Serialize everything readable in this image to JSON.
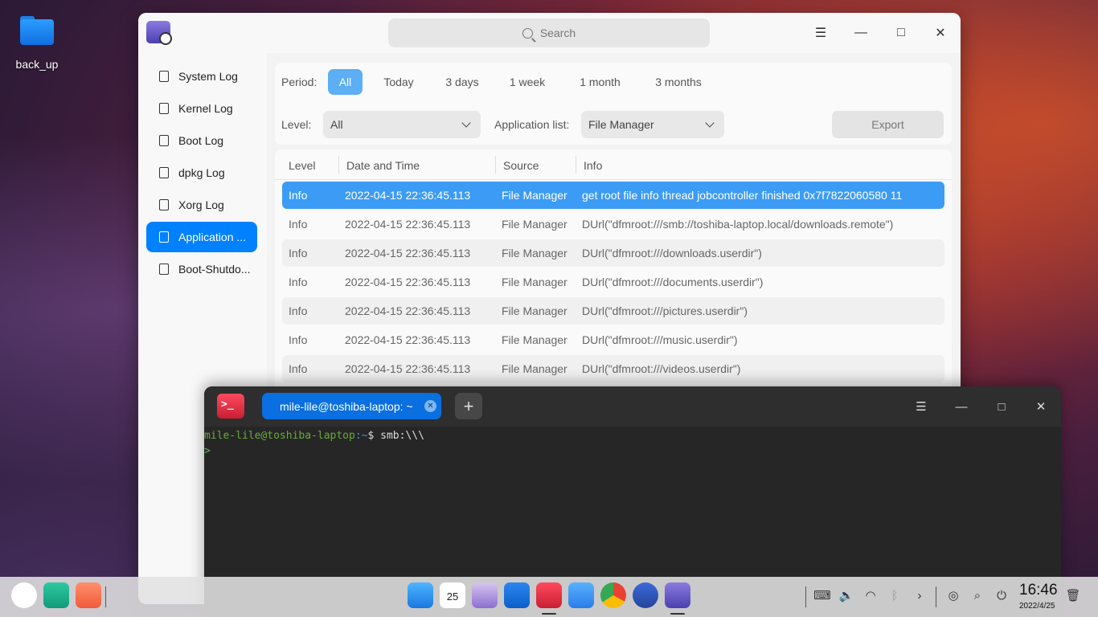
{
  "desktop": {
    "icons": [
      {
        "label": "back_up"
      }
    ]
  },
  "log_viewer": {
    "search_placeholder": "Search",
    "sidebar": [
      {
        "label": "System Log",
        "active": false
      },
      {
        "label": "Kernel Log",
        "active": false
      },
      {
        "label": "Boot Log",
        "active": false
      },
      {
        "label": "dpkg Log",
        "active": false
      },
      {
        "label": "Xorg Log",
        "active": false
      },
      {
        "label": "Application ...",
        "active": true
      },
      {
        "label": "Boot-Shutdo...",
        "active": false
      }
    ],
    "filters": {
      "period_label": "Period:",
      "periods": [
        "All",
        "Today",
        "3 days",
        "1 week",
        "1 month",
        "3 months"
      ],
      "period_selected": "All",
      "level_label": "Level:",
      "level_value": "All",
      "app_list_label": "Application list:",
      "app_list_value": "File Manager",
      "export_label": "Export"
    },
    "table": {
      "columns": [
        "Level",
        "Date and Time",
        "Source",
        "Info"
      ],
      "rows": [
        {
          "level": "Info",
          "datetime": "2022-04-15 22:36:45.113",
          "source": "File Manager",
          "info": "get root file info thread jobcontroller finished  0x7f7822060580 11",
          "selected": true
        },
        {
          "level": "Info",
          "datetime": "2022-04-15 22:36:45.113",
          "source": "File Manager",
          "info": "DUrl(\"dfmroot:///smb://toshiba-laptop.local/downloads.remote\")"
        },
        {
          "level": "Info",
          "datetime": "2022-04-15 22:36:45.113",
          "source": "File Manager",
          "info": "DUrl(\"dfmroot:///downloads.userdir\")"
        },
        {
          "level": "Info",
          "datetime": "2022-04-15 22:36:45.113",
          "source": "File Manager",
          "info": "DUrl(\"dfmroot:///documents.userdir\")"
        },
        {
          "level": "Info",
          "datetime": "2022-04-15 22:36:45.113",
          "source": "File Manager",
          "info": "DUrl(\"dfmroot:///pictures.userdir\")"
        },
        {
          "level": "Info",
          "datetime": "2022-04-15 22:36:45.113",
          "source": "File Manager",
          "info": "DUrl(\"dfmroot:///music.userdir\")"
        },
        {
          "level": "Info",
          "datetime": "2022-04-15 22:36:45.113",
          "source": "File Manager",
          "info": "DUrl(\"dfmroot:///videos.userdir\")"
        }
      ]
    }
  },
  "terminal": {
    "tab_title": "mile-lile@toshiba-laptop: ~",
    "prompt_user": "mile-lile@toshiba-laptop",
    "prompt_path": ":~",
    "prompt_symbol": "$ ",
    "command": "smb:\\\\\\",
    "continuation": ">"
  },
  "taskbar": {
    "time": "16:46",
    "date": "2022/4/25",
    "calendar_day": "25"
  },
  "colors": {
    "accent": "#0081ff",
    "selected_row": "#3c9cf5",
    "terminal_bg": "#262626",
    "prompt_user": "#6aaa3a"
  }
}
